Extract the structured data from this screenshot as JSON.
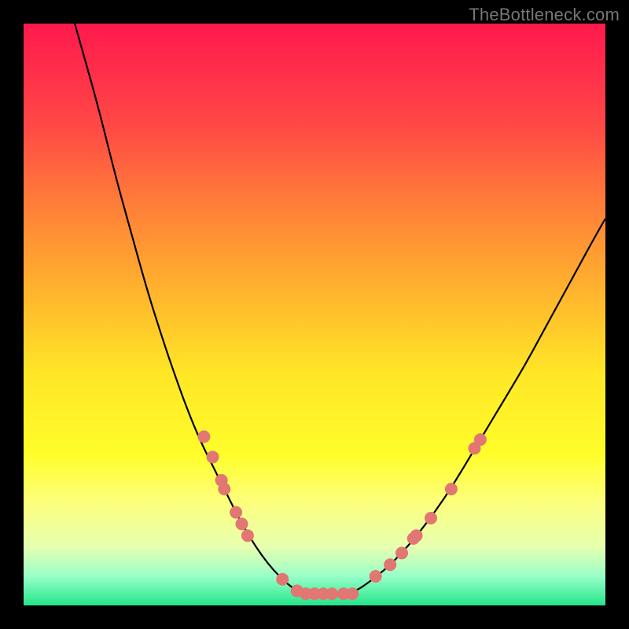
{
  "watermark": "TheBottleneck.com",
  "colors": {
    "curve_stroke": "#000000",
    "dot_fill": "#e27672",
    "dot_stroke": "#b85a57"
  },
  "chart_data": {
    "type": "line",
    "title": "",
    "xlabel": "",
    "ylabel": "",
    "xlim": [
      0,
      100
    ],
    "ylim": [
      0,
      100
    ],
    "left_curve": [
      {
        "x": 8.8,
        "y": 100.0
      },
      {
        "x": 10.5,
        "y": 94.0
      },
      {
        "x": 13.0,
        "y": 85.0
      },
      {
        "x": 16.0,
        "y": 73.0
      },
      {
        "x": 18.5,
        "y": 64.0
      },
      {
        "x": 21.0,
        "y": 55.0
      },
      {
        "x": 23.5,
        "y": 47.0
      },
      {
        "x": 25.5,
        "y": 41.0
      },
      {
        "x": 28.0,
        "y": 34.0
      },
      {
        "x": 30.5,
        "y": 28.0
      },
      {
        "x": 33.0,
        "y": 23.0
      },
      {
        "x": 35.0,
        "y": 19.0
      },
      {
        "x": 37.0,
        "y": 15.0
      },
      {
        "x": 39.0,
        "y": 11.5
      },
      {
        "x": 41.0,
        "y": 8.5
      },
      {
        "x": 43.0,
        "y": 6.0
      },
      {
        "x": 45.0,
        "y": 4.0
      },
      {
        "x": 46.5,
        "y": 2.8
      },
      {
        "x": 48.0,
        "y": 2.0
      }
    ],
    "flat": [
      {
        "x": 48.0,
        "y": 2.0
      },
      {
        "x": 50.0,
        "y": 2.0
      },
      {
        "x": 52.0,
        "y": 2.0
      },
      {
        "x": 54.0,
        "y": 2.0
      },
      {
        "x": 56.0,
        "y": 2.0
      }
    ],
    "right_curve": [
      {
        "x": 56.0,
        "y": 2.0
      },
      {
        "x": 58.0,
        "y": 3.0
      },
      {
        "x": 60.0,
        "y": 4.5
      },
      {
        "x": 62.5,
        "y": 6.5
      },
      {
        "x": 65.0,
        "y": 9.0
      },
      {
        "x": 68.0,
        "y": 12.5
      },
      {
        "x": 71.0,
        "y": 16.5
      },
      {
        "x": 74.0,
        "y": 21.0
      },
      {
        "x": 77.0,
        "y": 26.0
      },
      {
        "x": 80.0,
        "y": 31.0
      },
      {
        "x": 83.0,
        "y": 36.0
      },
      {
        "x": 86.0,
        "y": 41.0
      },
      {
        "x": 89.0,
        "y": 46.5
      },
      {
        "x": 92.0,
        "y": 52.0
      },
      {
        "x": 95.0,
        "y": 57.5
      },
      {
        "x": 98.0,
        "y": 63.0
      },
      {
        "x": 100.0,
        "y": 66.5
      }
    ],
    "dots": [
      {
        "x": 31.0,
        "y": 29.0
      },
      {
        "x": 32.5,
        "y": 25.5
      },
      {
        "x": 34.0,
        "y": 21.5
      },
      {
        "x": 34.5,
        "y": 20.0
      },
      {
        "x": 36.5,
        "y": 16.0
      },
      {
        "x": 37.5,
        "y": 14.0
      },
      {
        "x": 38.5,
        "y": 12.0
      },
      {
        "x": 44.5,
        "y": 4.5
      },
      {
        "x": 47.0,
        "y": 2.5
      },
      {
        "x": 48.5,
        "y": 2.0
      },
      {
        "x": 50.0,
        "y": 2.0
      },
      {
        "x": 51.5,
        "y": 2.0
      },
      {
        "x": 53.0,
        "y": 2.0
      },
      {
        "x": 55.0,
        "y": 2.0
      },
      {
        "x": 56.5,
        "y": 2.0
      },
      {
        "x": 60.5,
        "y": 5.0
      },
      {
        "x": 63.0,
        "y": 7.0
      },
      {
        "x": 65.0,
        "y": 9.0
      },
      {
        "x": 67.0,
        "y": 11.5
      },
      {
        "x": 67.5,
        "y": 12.0
      },
      {
        "x": 70.0,
        "y": 15.0
      },
      {
        "x": 73.5,
        "y": 20.0
      },
      {
        "x": 77.5,
        "y": 27.0
      },
      {
        "x": 78.5,
        "y": 28.5
      }
    ]
  }
}
